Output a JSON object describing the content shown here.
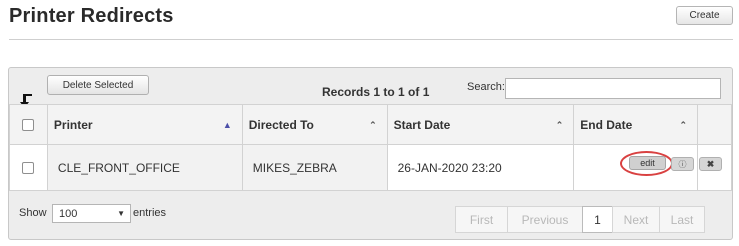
{
  "header": {
    "title": "Printer Redirects",
    "create_label": "Create"
  },
  "toolbar": {
    "delete_selected_label": "Delete Selected",
    "records_text": "Records 1 to 1 of 1",
    "search_label": "Search:",
    "search_value": ""
  },
  "table": {
    "columns": [
      {
        "label": "Printer",
        "sort": "asc"
      },
      {
        "label": "Directed To",
        "sort": "both"
      },
      {
        "label": "Start Date",
        "sort": "both"
      },
      {
        "label": "End Date",
        "sort": "both"
      }
    ],
    "rows": [
      {
        "printer": "CLE_FRONT_OFFICE",
        "directed_to": "MIKES_ZEBRA",
        "start_date": "26-JAN-2020 23:20",
        "end_date": "",
        "edit_label": "edit"
      }
    ]
  },
  "footer": {
    "show_label": "Show",
    "page_size": "100",
    "entries_label": "entries",
    "pagination": {
      "first": "First",
      "previous": "Previous",
      "current": "1",
      "next": "Next",
      "last": "Last"
    }
  },
  "icons": {
    "sort_asc": "triangle-up-icon",
    "sort_both": "chevron-up-icon",
    "info": "info-circle-icon",
    "delete": "x-icon",
    "annotation_arrow": "arrow-down-icon"
  },
  "colors": {
    "highlight_ring": "#d94141",
    "sort_active": "#4b4fa8"
  }
}
